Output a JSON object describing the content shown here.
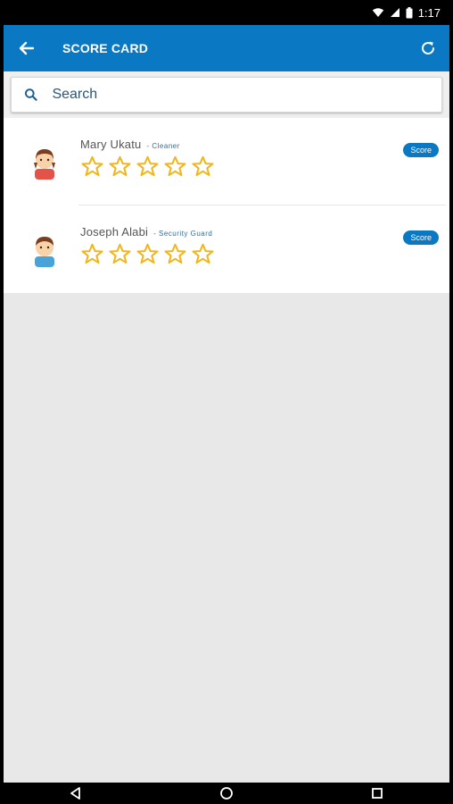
{
  "status": {
    "time": "1:17"
  },
  "appbar": {
    "title": "SCORE CARD"
  },
  "search": {
    "placeholder": "Search"
  },
  "list": [
    {
      "name": "Mary Ukatu",
      "role": "Cleaner",
      "score_label": "Score",
      "rating": 0,
      "max_rating": 5
    },
    {
      "name": "Joseph Alabi",
      "role": "Security Guard",
      "score_label": "Score",
      "rating": 0,
      "max_rating": 5
    }
  ],
  "colors": {
    "primary": "#0a78c2",
    "star": "#f2b51a",
    "background": "#e8e8e8"
  },
  "icons": {
    "back": "arrow-left-icon",
    "refresh": "refresh-icon",
    "search": "search-icon",
    "star": "star-outline-icon"
  }
}
